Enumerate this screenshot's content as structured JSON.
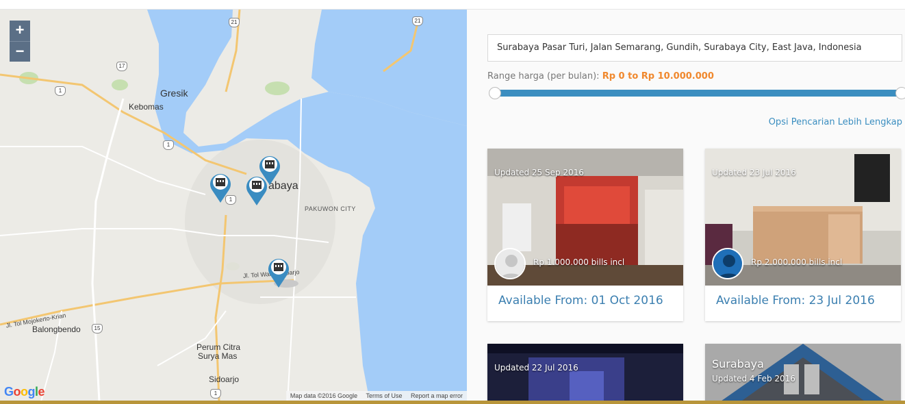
{
  "map": {
    "zoom_in": "+",
    "zoom_out": "−",
    "labels": {
      "gresik": "Gresik",
      "kebomas": "Kebomas",
      "surabaya": "abaya",
      "pakuwon": "PAKUWON CITY",
      "tol": "Jl. Tol Waru-Sidoarjo",
      "tol_mojokerto": "Jl. Tol Mojokerto-Krian",
      "balongbendo": "Balongbendo",
      "perum": "Perum Citra",
      "surya": "Surya Mas",
      "sidoarjo": "Sidoarjo"
    },
    "shields": [
      "21",
      "21",
      "17",
      "1",
      "1",
      "1",
      "15",
      "1"
    ],
    "attribution": {
      "data": "Map data ©2016 Google",
      "terms": "Terms of Use",
      "report": "Report a map error"
    },
    "google": "Google"
  },
  "search": {
    "value": "Surabaya Pasar Turi, Jalan Semarang, Gundih, Surabaya City, East Java, Indonesia"
  },
  "range": {
    "label": "Range harga (per bulan): ",
    "value": "Rp 0 to Rp 10.000.000",
    "accent": "#3b8ec0",
    "value_color": "#f0882d"
  },
  "more_options": "Opsi Pencarian Lebih Lengkap",
  "cards": [
    {
      "updated": "Updated 25 Sep 2016",
      "price": "Rp 1.000.000 bills incl",
      "available": "Available From: 01 Oct 2016"
    },
    {
      "updated": "Updated 23 Jul 2016",
      "price": "Rp 2.000.000 bills incl",
      "available": "Available From: 23 Jul 2016"
    },
    {
      "updated": "Updated 22 Jul 2016"
    },
    {
      "city": "Surabaya",
      "updated": "Updated 4 Feb 2016"
    }
  ]
}
